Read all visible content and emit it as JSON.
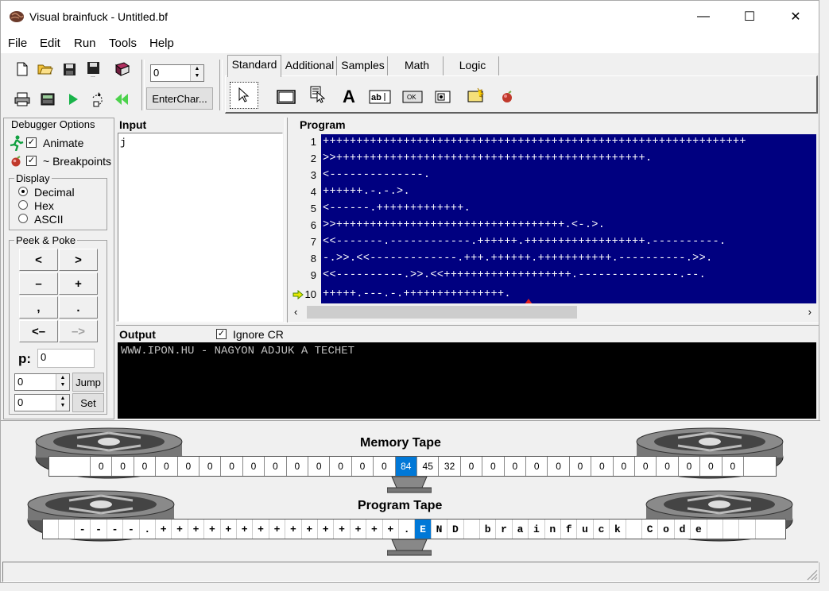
{
  "window": {
    "title": "Visual brainfuck - Untitled.bf",
    "minimize": "—",
    "maximize": "☐",
    "close": "✕"
  },
  "menu": [
    "File",
    "Edit",
    "Run",
    "Tools",
    "Help"
  ],
  "toolbar": {
    "spin_value": "0",
    "enter_char_label": "EnterChar..."
  },
  "tabs": [
    "Standard",
    "Additional",
    "Samples",
    "Math",
    "Logic"
  ],
  "debugger": {
    "title": "Debugger Options",
    "animate_label": "Animate",
    "animate_checked": "✓",
    "breakpoints_label": "~ Breakpoints",
    "breakpoints_checked": "✓"
  },
  "display": {
    "title": "Display",
    "options": [
      "Decimal",
      "Hex",
      "ASCII"
    ],
    "selected": "Decimal"
  },
  "peek_poke": {
    "title": "Peek & Poke",
    "buttons": [
      "<",
      ">",
      "–",
      "+",
      ",",
      ".",
      "<–",
      "–>"
    ],
    "p_label": "p:",
    "p_value": "0",
    "jump_value": "0",
    "set_value": "0",
    "jump_label": "Jump",
    "set_label": "Set"
  },
  "input": {
    "header": "Input",
    "text": "j"
  },
  "program": {
    "header": "Program",
    "line_numbers": [
      "1",
      "2",
      "3",
      "4",
      "5",
      "6",
      "7",
      "8",
      "9",
      "10"
    ],
    "lines": [
      "+++++++++++++++++++++++++++++++++++++++++++++++++++++++++++++++",
      ">>++++++++++++++++++++++++++++++++++++++++++++++.",
      "<--------------.",
      "++++++.-.-.>.",
      "<------.+++++++++++++.",
      ">>++++++++++++++++++++++++++++++++++.<-.>.",
      "<<-------.------------.++++++.++++++++++++++++++.----------.",
      "-.>>.<<-------------.+++.++++++.+++++++++++.----------.>>.",
      "<<----------.>>.<<+++++++++++++++++++.---------------.--.",
      "+++++.---.-.+++++++++++++++."
    ]
  },
  "output": {
    "header": "Output",
    "ignore_cr_label": "Ignore CR",
    "ignore_cr_checked": "✓",
    "text": "WWW.IPON.HU - NAGYON ADJUK A TECHET"
  },
  "memory_tape": {
    "title": "Memory Tape",
    "cells": [
      "0",
      "0",
      "0",
      "0",
      "0",
      "0",
      "0",
      "0",
      "0",
      "0",
      "0",
      "0",
      "0",
      "0",
      "84",
      "45",
      "32",
      "0",
      "0",
      "0",
      "0",
      "0",
      "0",
      "0",
      "0",
      "0",
      "0",
      "0",
      "0",
      "0"
    ],
    "current_index": 14
  },
  "program_tape": {
    "title": "Program Tape",
    "cells": [
      "-",
      "-",
      "-",
      "-",
      ".",
      "+",
      "+",
      "+",
      "+",
      "+",
      "+",
      "+",
      "+",
      "+",
      "+",
      "+",
      "+",
      "+",
      "+",
      "+",
      ".",
      "E",
      "N",
      "D",
      " ",
      "b",
      "r",
      "a",
      "i",
      "n",
      "f",
      "u",
      "c",
      "k",
      " ",
      "C",
      "o",
      "d",
      "e",
      " ",
      " ",
      " "
    ],
    "current_index": 21
  },
  "colors": {
    "code_bg": "#000080",
    "highlight": "#0078d7",
    "output_bg": "#000000"
  }
}
